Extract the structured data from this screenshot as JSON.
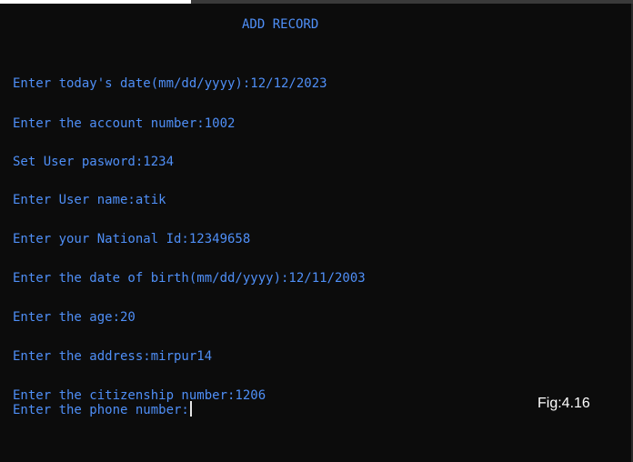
{
  "terminal": {
    "heading": "ADD RECORD",
    "lines": [
      "Enter today's date(mm/dd/yyyy):12/12/2023",
      "Enter the account number:1002",
      "Set User pasword:1234",
      "Enter User name:atik",
      "Enter your National Id:12349658",
      "Enter the date of birth(mm/dd/yyyy):12/11/2003",
      "Enter the age:20",
      "Enter the address:mirpur14",
      "Enter the citizenship number:1206",
      "Enter the phone number:"
    ]
  },
  "caption": "Fig:4.16",
  "colors": {
    "background": "#0c0c0c",
    "text": "#4f8ff7",
    "cursor": "#e6e6e6",
    "caption": "#ffffff"
  }
}
